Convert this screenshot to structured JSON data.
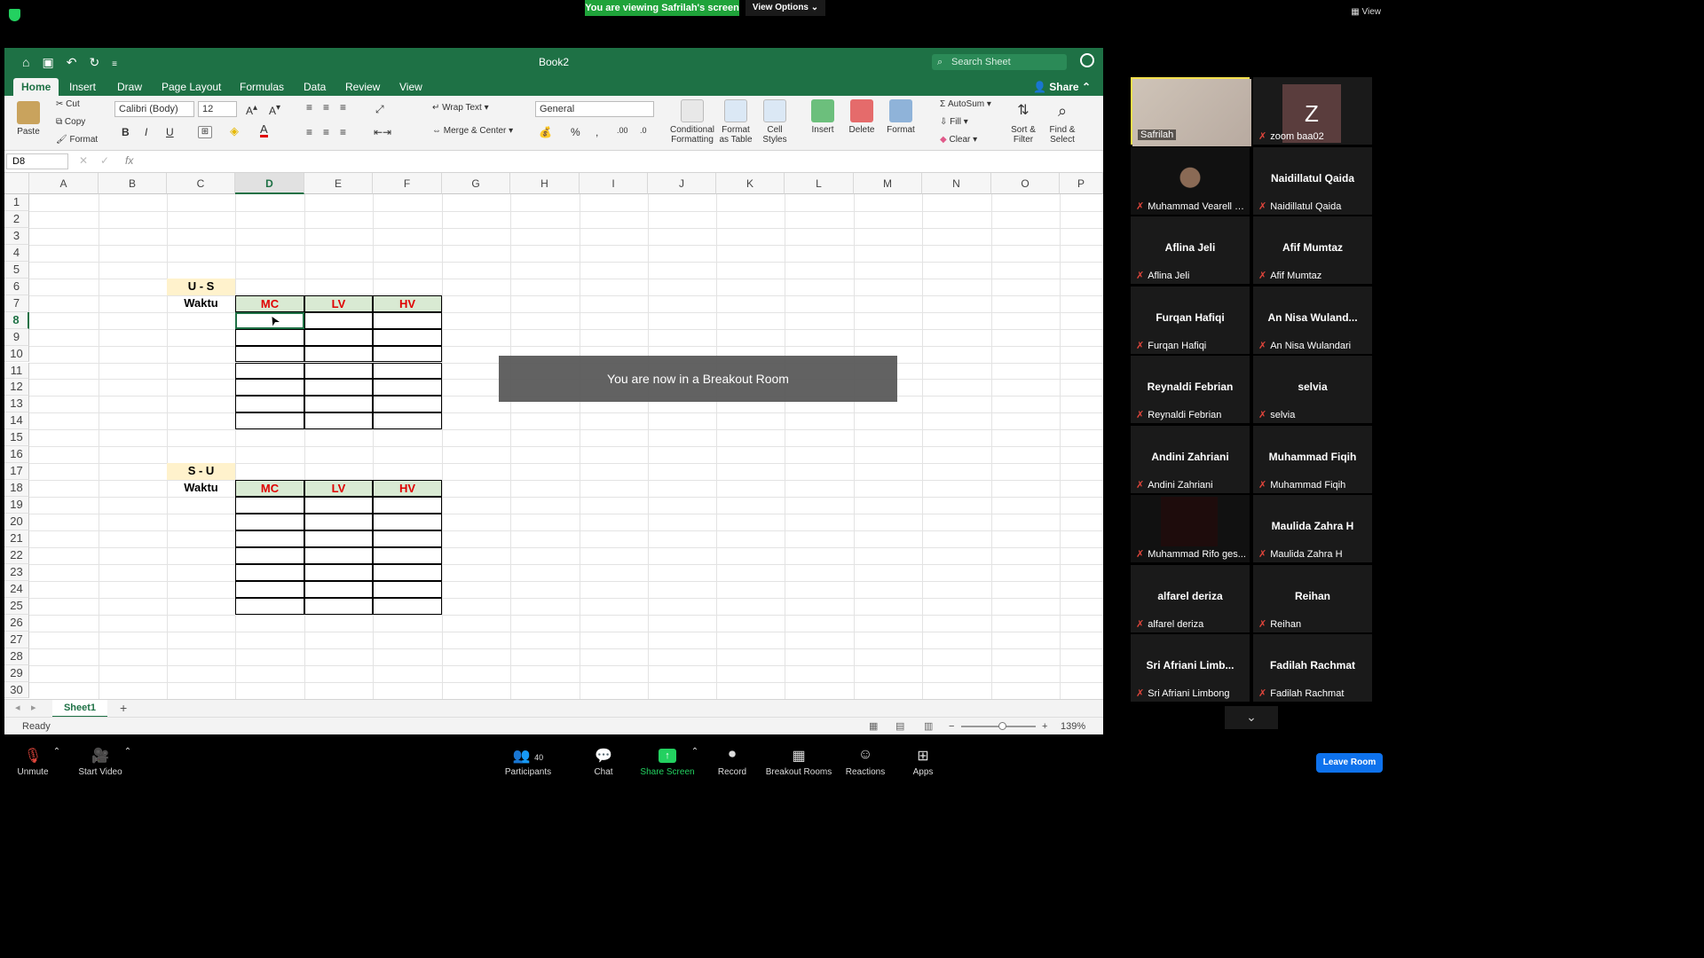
{
  "zoom": {
    "viewing_banner": "You are viewing Safrilah's screen",
    "view_options": "View Options",
    "view_label": "View",
    "breakout_message": "You are now in a Breakout Room",
    "toolbar": {
      "unmute": "Unmute",
      "start_video": "Start Video",
      "participants": "Participants",
      "participant_count": "40",
      "chat": "Chat",
      "share_screen": "Share Screen",
      "record": "Record",
      "breakout_rooms": "Breakout Rooms",
      "reactions": "Reactions",
      "apps": "Apps",
      "leave_room": "Leave Room"
    },
    "participants": [
      {
        "big": "",
        "name": "Safrilah"
      },
      {
        "big": "Z",
        "name": "zoom baa02"
      },
      {
        "big": "",
        "name": "Muhammad Vearell R..."
      },
      {
        "big": "Naidillatul Qaida",
        "name": "Naidillatul Qaida"
      },
      {
        "big": "Aflina Jeli",
        "name": "Aflina Jeli"
      },
      {
        "big": "Afif Mumtaz",
        "name": "Afif Mumtaz"
      },
      {
        "big": "Furqan Hafiqi",
        "name": "Furqan Hafiqi"
      },
      {
        "big": "An Nisa Wuland...",
        "name": "An Nisa Wulandari"
      },
      {
        "big": "Reynaldi Febrian",
        "name": "Reynaldi Febrian"
      },
      {
        "big": "selvia",
        "name": "selvia"
      },
      {
        "big": "Andini Zahriani",
        "name": "Andini Zahriani"
      },
      {
        "big": "Muhammad Fiqih",
        "name": "Muhammad Fiqih"
      },
      {
        "big": "",
        "name": "Muhammad Rifo ges..."
      },
      {
        "big": "Maulida Zahra H",
        "name": "Maulida Zahra H"
      },
      {
        "big": "alfarel deriza",
        "name": "alfarel deriza"
      },
      {
        "big": "Reihan",
        "name": "Reihan"
      },
      {
        "big": "Sri Afriani Limb...",
        "name": "Sri Afriani Limbong"
      },
      {
        "big": "Fadilah Rachmat",
        "name": "Fadilah Rachmat"
      }
    ]
  },
  "excel": {
    "title": "Book2",
    "search_placeholder": "Search Sheet",
    "tabs": [
      "Home",
      "Insert",
      "Draw",
      "Page Layout",
      "Formulas",
      "Data",
      "Review",
      "View"
    ],
    "share": "Share",
    "ribbon": {
      "paste": "Paste",
      "cut": "Cut",
      "copy": "Copy",
      "format_painter": "Format",
      "font_name": "Calibri (Body)",
      "font_size": "12",
      "bold": "B",
      "italic": "I",
      "underline": "U",
      "wrap_text": "Wrap Text",
      "merge_center": "Merge & Center",
      "number_format": "General",
      "percent": "%",
      "comma": ",",
      "conditional_formatting": "Conditional\nFormatting",
      "format_as_table": "Format\nas Table",
      "cell_styles": "Cell\nStyles",
      "insert": "Insert",
      "delete": "Delete",
      "format": "Format",
      "autosum": "AutoSum",
      "fill": "Fill",
      "clear": "Clear",
      "sort_filter": "Sort &\nFilter",
      "find_select": "Find &\nSelect"
    },
    "name_box": "D8",
    "fx": "fx",
    "columns": [
      "A",
      "B",
      "C",
      "D",
      "E",
      "F",
      "G",
      "H",
      "I",
      "J",
      "K",
      "L",
      "M",
      "N",
      "O",
      "P"
    ],
    "rows": [
      "1",
      "2",
      "3",
      "4",
      "5",
      "6",
      "7",
      "8",
      "9",
      "10",
      "11",
      "12",
      "13",
      "14",
      "15",
      "16",
      "17",
      "18",
      "19",
      "20",
      "21",
      "22",
      "23",
      "24",
      "25",
      "26",
      "27",
      "28",
      "29",
      "30"
    ],
    "table1": {
      "title": "U - S",
      "row_label": "Waktu",
      "headers": [
        "MC",
        "LV",
        "HV"
      ]
    },
    "table2": {
      "title": "S - U",
      "row_label": "Waktu",
      "headers": [
        "MC",
        "LV",
        "HV"
      ]
    },
    "sheet_tab": "Sheet1",
    "add_sheet": "+",
    "status": "Ready",
    "zoom_level": "139%"
  }
}
